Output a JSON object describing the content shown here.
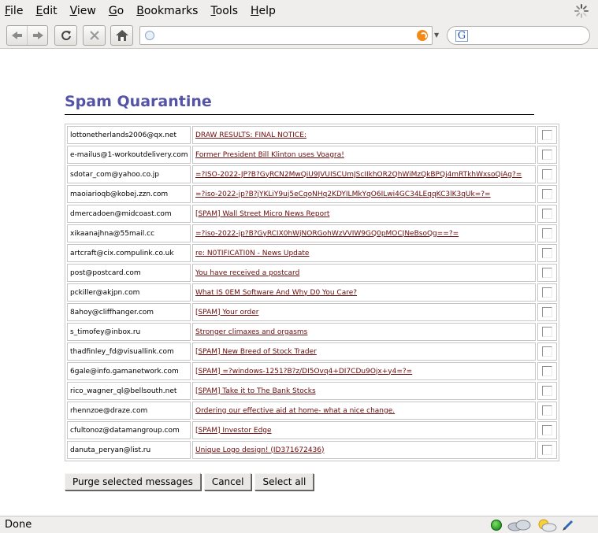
{
  "menubar": {
    "items": [
      {
        "key": "file",
        "first": "F",
        "rest": "ile"
      },
      {
        "key": "edit",
        "first": "E",
        "rest": "dit"
      },
      {
        "key": "view",
        "first": "V",
        "rest": "iew"
      },
      {
        "key": "go",
        "first": "G",
        "rest": "o"
      },
      {
        "key": "bookmarks",
        "first": "B",
        "rest": "ookmarks"
      },
      {
        "key": "tools",
        "first": "T",
        "rest": "ools"
      },
      {
        "key": "help",
        "first": "H",
        "rest": "elp"
      }
    ]
  },
  "toolbar": {
    "url": "",
    "search_value": "",
    "icons": {
      "back": "back-arrow-icon",
      "forward": "forward-arrow-icon",
      "reload": "reload-icon",
      "stop": "stop-icon",
      "home": "home-icon",
      "site": "page-icon",
      "feed": "rss-feed-icon",
      "search_engine": "google-icon"
    },
    "search_engine_glyph": "G"
  },
  "page": {
    "title": "Spam Quarantine",
    "title_color": "#5453a8",
    "link_color": "#6b0a0a"
  },
  "messages": [
    {
      "sender": "lottonetherlands2006@qx.net",
      "subject": "DRAW RESULTS: FINAL NOTICE:",
      "checked": false
    },
    {
      "sender": "e-mailus@1-workoutdelivery.com",
      "subject": "Former President Bill Klinton uses Voagra!",
      "checked": false
    },
    {
      "sender": "sdotar_com@yahoo.co.jp",
      "subject": "=?ISO-2022-JP?B?GyRCN2MwQiU9JVUISCUmJScIIkhOR2QhWiMzQkBPQj4mRTkhWxsoQiAg?=",
      "checked": false
    },
    {
      "sender": "maoiarioqb@kobej.zzn.com",
      "subject": "=?iso-2022-jp?B?jYKLiY9uj5eCqoNHq2KDYILMkYqO6ILwi4GC34LEqqKC3lK3qUk=?=",
      "checked": false
    },
    {
      "sender": "dmercadoen@midcoast.com",
      "subject": "[SPAM] Wall Street Micro News Report",
      "checked": false
    },
    {
      "sender": "xikaanajhna@55mail.cc",
      "subject": "=?iso-2022-jp?B?GyRCIX0hWjNORGohWzVVIW9GQ0pMOCJNeBsoQg==?=",
      "checked": false
    },
    {
      "sender": "artcraft@cix.compulink.co.uk",
      "subject": "re: N0TIFICATI0N - News Update",
      "checked": false
    },
    {
      "sender": "post@postcard.com",
      "subject": "You have received a postcard",
      "checked": false
    },
    {
      "sender": "pckiller@akjpn.com",
      "subject": "What IS 0EM Software And Why D0 You Care?",
      "checked": false
    },
    {
      "sender": "8ahoy@cliffhanger.com",
      "subject": "[SPAM] Your order",
      "checked": false
    },
    {
      "sender": "s_timofey@inbox.ru",
      "subject": "Stronger climaxes and orgasms",
      "checked": false
    },
    {
      "sender": "thadfinley_fd@visuallink.com",
      "subject": "[SPAM] New Breed of Stock Trader",
      "checked": false
    },
    {
      "sender": "6gale@info.gamanetwork.com",
      "subject": "[SPAM] =?windows-1251?B?z/DI5Ovq4+DI7CDu9Ojx+y4=?=",
      "checked": false
    },
    {
      "sender": "rico_wagner_ql@bellsouth.net",
      "subject": "[SPAM] Take it to The Bank Stocks",
      "checked": false
    },
    {
      "sender": "rhennzoe@draze.com",
      "subject": "Ordering our effective aid at home- what a nice change.",
      "checked": false
    },
    {
      "sender": "cfultonoz@datamangroup.com",
      "subject": "[SPAM] Investor Edge",
      "checked": false
    },
    {
      "sender": "danuta_peryan@list.ru",
      "subject": "Unique Logo design! (ID371672436)",
      "checked": false
    }
  ],
  "actions": {
    "purge_label": "Purge selected messages",
    "cancel_label": "Cancel",
    "select_all_label": "Select all"
  },
  "statusbar": {
    "text": "Done",
    "icons": [
      "online-status-icon",
      "weather-cloud-icon",
      "weather-sun-icon",
      "edit-pen-icon"
    ]
  }
}
